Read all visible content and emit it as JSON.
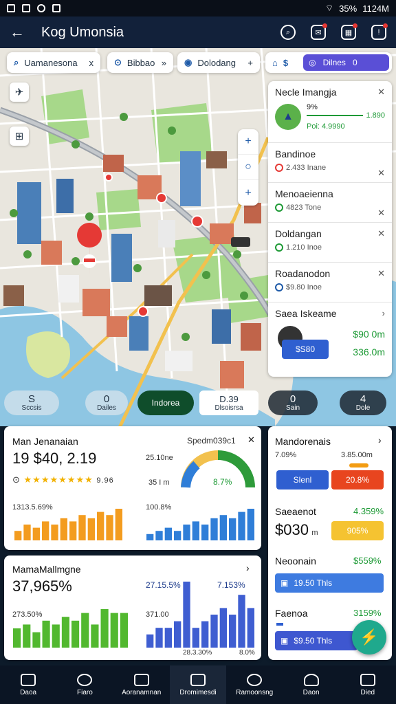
{
  "status": {
    "time": "1124M",
    "battery": "35%"
  },
  "header": {
    "title": "Kog Umonsia",
    "back_icon": "arrow-left-icon"
  },
  "search_chips": [
    {
      "label": "Uamanesona",
      "icon": "search-icon",
      "action": "x"
    },
    {
      "label": "Bibbao",
      "icon": "calendar-icon",
      "action": "»"
    },
    {
      "label": "Dolodang",
      "icon": "location-icon",
      "action": "+"
    }
  ],
  "top_right_chips": {
    "left_icon": "$",
    "pill_label": "Dilnes",
    "pill_num": "0"
  },
  "map_controls": [
    "+",
    "○",
    "+"
  ],
  "right_panel": [
    {
      "title": "Necle Imangja",
      "v1": "1.890",
      "v2": "Poi: 4.9990",
      "pct": "9%"
    },
    {
      "title": "Bandinoe",
      "sub": "2.433 Inane",
      "ring": "#e53935"
    },
    {
      "title": "Menoaeienna",
      "sub": "4823 Tone",
      "ring": "#1e9a36"
    },
    {
      "title": "Doldangan",
      "sub": "1.210 Inoe",
      "ring": "#1e9a36"
    },
    {
      "title": "Roadanodon",
      "sub": "$9.80 Inoe",
      "ring": "#1e5aa8"
    },
    {
      "title": "Saea Iskeame",
      "v1": "$90 0m",
      "v2": "336.0m",
      "btn": "$S80"
    }
  ],
  "quick_bar": [
    {
      "num": "S",
      "label": "Sccsis"
    },
    {
      "num": "0",
      "label": "Dailes"
    },
    {
      "num": "",
      "label": "Indorea"
    },
    {
      "num": "D.39",
      "label": "Dlsoisrsa"
    },
    {
      "num": "0",
      "label": "Sain"
    },
    {
      "num": "4",
      "label": "Dole"
    }
  ],
  "card1": {
    "title": "Man Jenanaian",
    "value": "19 $40, 2.19",
    "right_title": "Spedm039c1",
    "mid1": "25.10ne",
    "mid2": "35 I m",
    "gauge_pct": "8.7%",
    "stars": "9.96",
    "bars_left_label": "1313.5.69%",
    "bars_right_label": "100.8%"
  },
  "card2": {
    "title": "MamaMallmgne",
    "value": "37,965%",
    "stat1": "27.15.5%",
    "stat2": "7.153%",
    "left_label": "273.50%",
    "right_label": "371.00",
    "foot1": "28.3.30%",
    "foot2": "8.0%"
  },
  "card3": {
    "title": "Mandorenais",
    "pct": "7.09%",
    "val": "3.85.00m",
    "btn_blue": "Slenl",
    "btn_red": "20.8%",
    "sec2_title": "Saeaenot",
    "sec2_pct": "4.359%",
    "sec2_value": "$030",
    "sec2_unit": "m",
    "btn_yellow": "905%",
    "sec3_title": "Neoonain",
    "sec3_pct": "$559%",
    "btn_blue2": "19.50 Thls",
    "sec4_title": "Faenoa",
    "sec4_pct": "3159%",
    "btn_blue3": "$9.50 Thls"
  },
  "bottom_nav": [
    {
      "label": "Daoa",
      "icon": "home-icon"
    },
    {
      "label": "Fiaro",
      "icon": "compass-icon"
    },
    {
      "label": "Aoranamnan",
      "icon": "doc-icon"
    },
    {
      "label": "Dromimesdi",
      "icon": "grid-icon"
    },
    {
      "label": "Ramoonsng",
      "icon": "refresh-icon"
    },
    {
      "label": "Daon",
      "icon": "user-icon"
    },
    {
      "label": "Died",
      "icon": "square-icon"
    }
  ],
  "bar_series": {
    "card1_left": [
      3,
      5,
      4,
      6,
      5,
      7,
      6,
      8,
      7,
      9,
      8,
      10
    ],
    "card1_right": [
      2,
      3,
      4,
      3,
      5,
      6,
      5,
      7,
      8,
      7,
      9,
      10
    ],
    "card2_left": [
      5,
      6,
      4,
      7,
      6,
      8,
      7,
      9,
      6,
      10,
      9,
      9
    ],
    "card2_right": [
      2,
      3,
      3,
      4,
      10,
      3,
      4,
      5,
      6,
      5,
      8,
      6
    ]
  }
}
